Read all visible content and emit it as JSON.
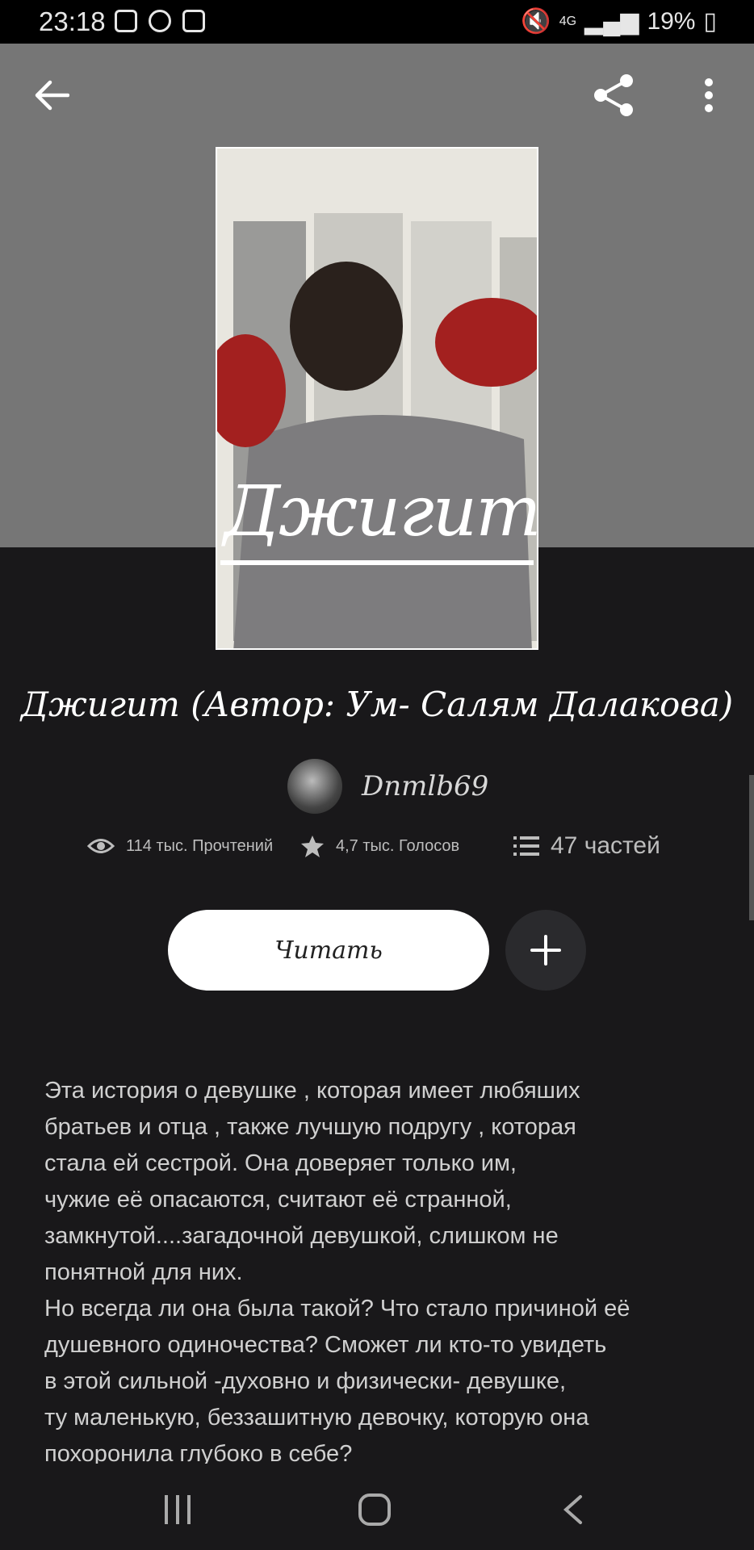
{
  "status_bar": {
    "time": "23:18",
    "battery": "19%",
    "network": "4G",
    "icons": [
      "image-icon",
      "download-icon",
      "wifi-icon",
      "mute-icon",
      "signal-icon",
      "battery-icon"
    ]
  },
  "toolbar": {
    "icons": [
      "back-arrow-icon",
      "share-icon",
      "more-vert-icon"
    ]
  },
  "cover": {
    "title": "Джигит"
  },
  "story": {
    "title": "Джигит (Автор: Ум- Салям Далакова)",
    "author": "Dnmlb69"
  },
  "stats": {
    "reads": "114 тыс. Прочтений",
    "votes": "4,7 тыс. Голосов",
    "parts": "47 частей"
  },
  "actions": {
    "read_label": "Читать"
  },
  "description": {
    "lines": [
      "Эта история о девушке , которая имеет любяших",
      "братьев и отца , также лучшую подругу , которая",
      "стала ей сестрой. Она доверяет только им,",
      "чужие её опасаются, считают её странной,",
      "замкнутой....загадочной девушкой, слишком не",
      "понятной для них.",
      "Но всегда ли она была такой? Что стало причиной её",
      "душевного одиночества? Сможет ли кто-то увидеть",
      "в этой сильной -духовно и физически- девушке,",
      "ту маленькую, беззашитную девочку, которую она",
      "похоронила глубоко в себе?"
    ]
  },
  "colors": {
    "background": "#19181a",
    "hero": "#767676",
    "button_white": "#ffffff",
    "add_button": "#2a2a2d"
  }
}
